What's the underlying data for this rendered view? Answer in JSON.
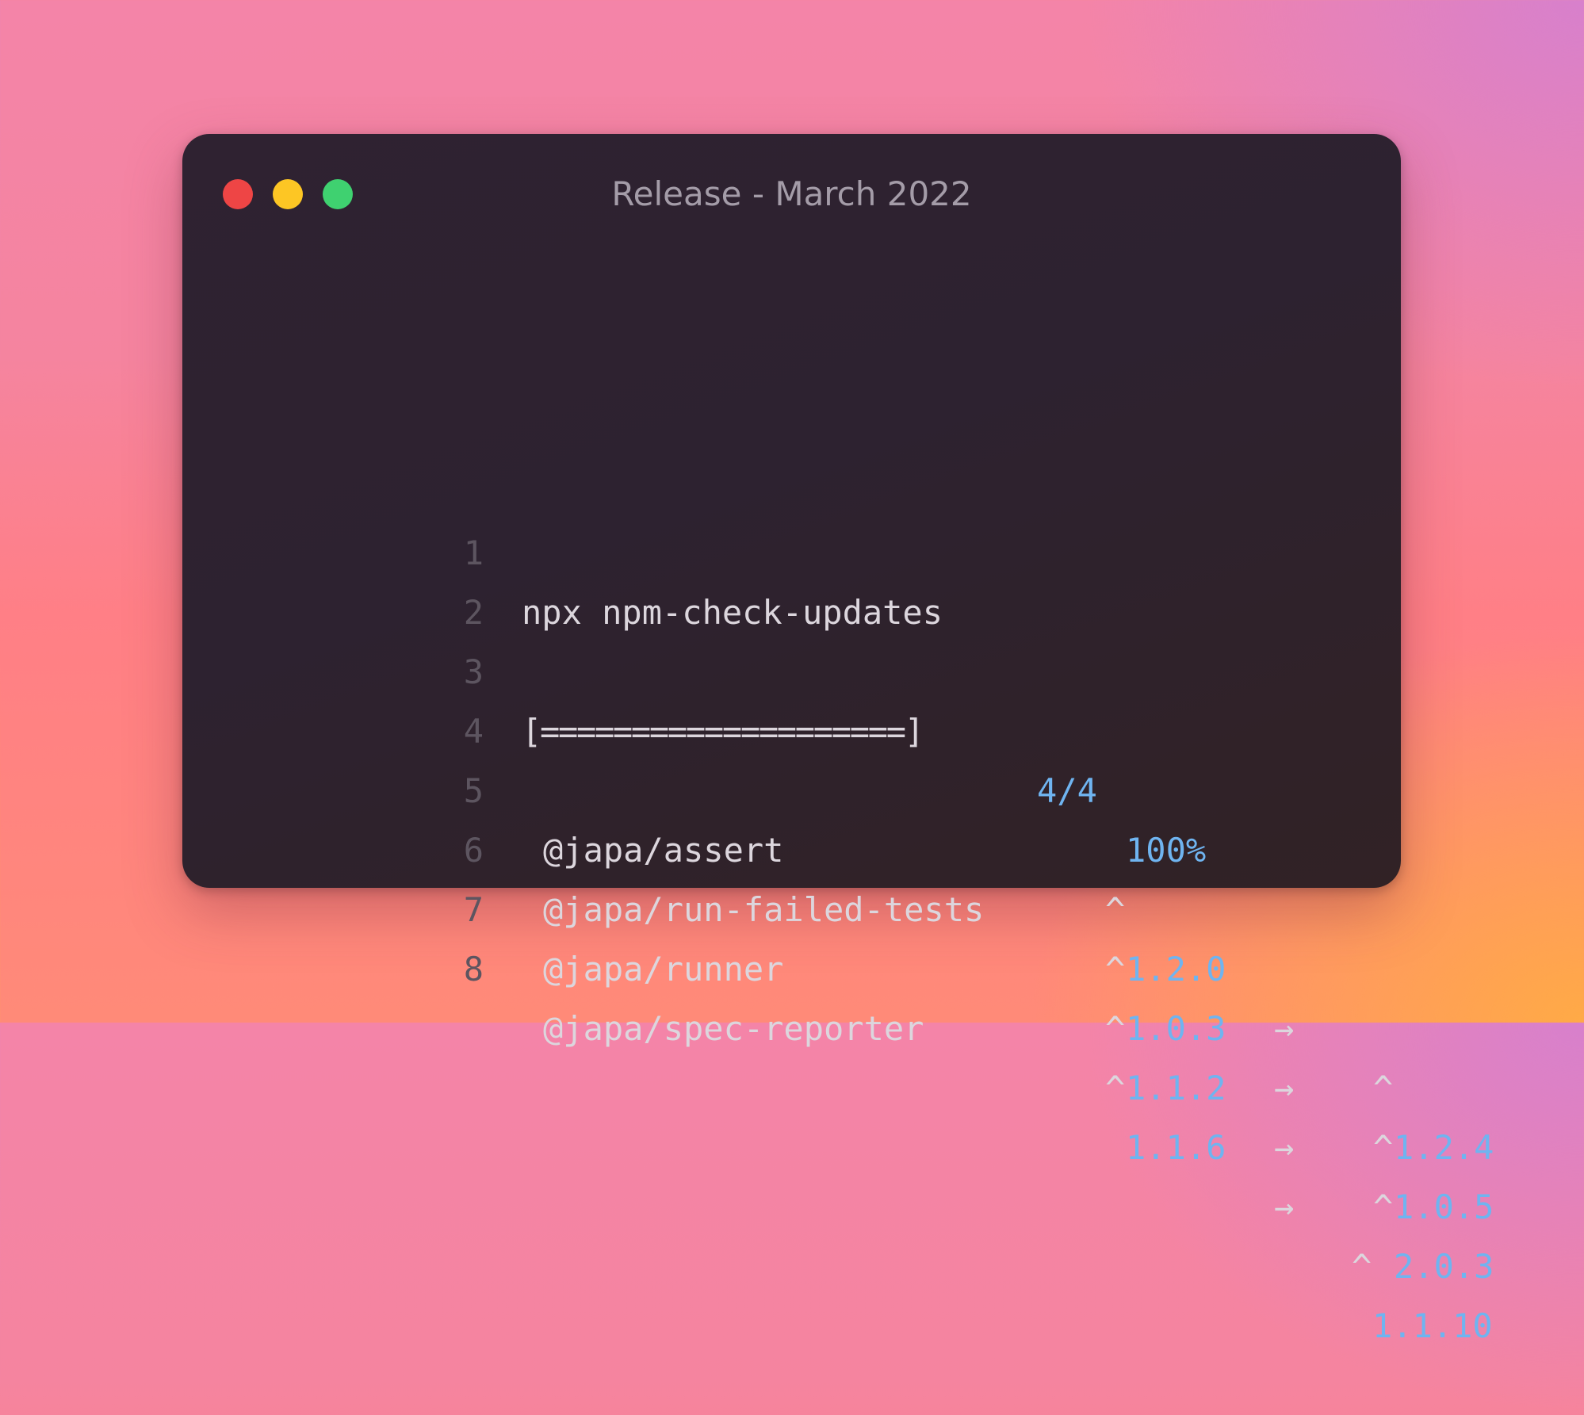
{
  "window": {
    "title": "Release - March 2022"
  },
  "code": {
    "line_numbers": [
      "1",
      "2",
      "3",
      "4",
      "5",
      "6",
      "7",
      "8"
    ],
    "command": "npx npm-check-updates",
    "progress_bar": "[====================]",
    "progress_count": "4/4",
    "progress_percent": "100%",
    "packages": [
      {
        "name": "@japa/assert",
        "from_caret": "^",
        "from": "1.2.0",
        "arrow": "→",
        "to_caret": "^",
        "to": "1.2.4"
      },
      {
        "name": "@japa/run-failed-tests",
        "from_caret": "^",
        "from": "1.0.3",
        "arrow": "→",
        "to_caret": "^",
        "to": "1.0.5"
      },
      {
        "name": "@japa/runner",
        "from_caret": "^",
        "from": "1.1.2",
        "arrow": "→",
        "to_caret": "^",
        "to": "2.0.3"
      },
      {
        "name": "@japa/spec-reporter",
        "from_caret": "^",
        "from": "1.1.6",
        "arrow": "→",
        "to_caret": "^",
        "to": "1.1.10"
      }
    ]
  },
  "colors": {
    "window_bg": "#2f2231",
    "close": "#ee4545",
    "minimize": "#fdc624",
    "zoom": "#3fd170",
    "text": "#dcd6dd",
    "accent": "#6fb4f0",
    "line_number": "#5d5560"
  }
}
